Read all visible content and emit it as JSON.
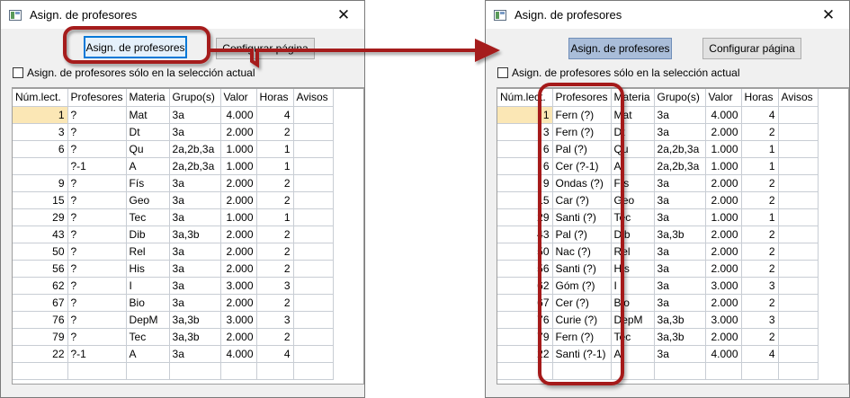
{
  "colors": {
    "callout": "#a51a1a",
    "selected_row": "#fbe7b5",
    "pressed_button": "#a9bdd9"
  },
  "left": {
    "window_title": "Asign. de profesores",
    "assign_button": "Asign. de profesores",
    "config_button": "Configurar página",
    "checkbox_label": "Asign. de profesores sólo en la selección actual",
    "columns": [
      "Núm.lect.",
      "Profesores",
      "Materia",
      "Grupo(s)",
      "Valor",
      "Horas",
      "Avisos"
    ],
    "rows": [
      [
        "1",
        "?",
        "Mat",
        "3a",
        "4.000",
        "4",
        ""
      ],
      [
        "3",
        "?",
        "Dt",
        "3a",
        "2.000",
        "2",
        ""
      ],
      [
        "6",
        "?",
        "Qu",
        "2a,2b,3a",
        "1.000",
        "1",
        ""
      ],
      [
        "",
        "?-1",
        "A",
        "2a,2b,3a",
        "1.000",
        "1",
        ""
      ],
      [
        "9",
        "?",
        "Fís",
        "3a",
        "2.000",
        "2",
        ""
      ],
      [
        "15",
        "?",
        "Geo",
        "3a",
        "2.000",
        "2",
        ""
      ],
      [
        "29",
        "?",
        "Tec",
        "3a",
        "1.000",
        "1",
        ""
      ],
      [
        "43",
        "?",
        "Dib",
        "3a,3b",
        "2.000",
        "2",
        ""
      ],
      [
        "50",
        "?",
        "Rel",
        "3a",
        "2.000",
        "2",
        ""
      ],
      [
        "56",
        "?",
        "His",
        "3a",
        "2.000",
        "2",
        ""
      ],
      [
        "62",
        "?",
        "I",
        "3a",
        "3.000",
        "3",
        ""
      ],
      [
        "67",
        "?",
        "Bio",
        "3a",
        "2.000",
        "2",
        ""
      ],
      [
        "76",
        "?",
        "DepM",
        "3a,3b",
        "3.000",
        "3",
        ""
      ],
      [
        "79",
        "?",
        "Tec",
        "3a,3b",
        "2.000",
        "2",
        ""
      ],
      [
        "22",
        "?-1",
        "A",
        "3a",
        "4.000",
        "4",
        ""
      ]
    ]
  },
  "right": {
    "window_title": "Asign. de profesores",
    "assign_button": "Asign. de profesores",
    "config_button": "Configurar página",
    "checkbox_label": "Asign. de profesores sólo en la selección actual",
    "columns": [
      "Núm.lect.",
      "Profesores",
      "Materia",
      "Grupo(s)",
      "Valor",
      "Horas",
      "Avisos"
    ],
    "rows": [
      [
        "1",
        "Fern (?)",
        "Mat",
        "3a",
        "4.000",
        "4",
        ""
      ],
      [
        "3",
        "Fern (?)",
        "Dt",
        "3a",
        "2.000",
        "2",
        ""
      ],
      [
        "6",
        "Pal (?)",
        "Qu",
        "2a,2b,3a",
        "1.000",
        "1",
        ""
      ],
      [
        "6",
        "Cer (?-1)",
        "A",
        "2a,2b,3a",
        "1.000",
        "1",
        ""
      ],
      [
        "9",
        "Ondas (?)",
        "Fís",
        "3a",
        "2.000",
        "2",
        ""
      ],
      [
        "15",
        "Car (?)",
        "Geo",
        "3a",
        "2.000",
        "2",
        ""
      ],
      [
        "29",
        "Santi (?)",
        "Tec",
        "3a",
        "1.000",
        "1",
        ""
      ],
      [
        "43",
        "Pal (?)",
        "Dib",
        "3a,3b",
        "2.000",
        "2",
        ""
      ],
      [
        "50",
        "Nac (?)",
        "Rel",
        "3a",
        "2.000",
        "2",
        ""
      ],
      [
        "56",
        "Santi (?)",
        "His",
        "3a",
        "2.000",
        "2",
        ""
      ],
      [
        "62",
        "Góm (?)",
        "I",
        "3a",
        "3.000",
        "3",
        ""
      ],
      [
        "67",
        "Cer (?)",
        "Bio",
        "3a",
        "2.000",
        "2",
        ""
      ],
      [
        "76",
        "Curie (?)",
        "DepM",
        "3a,3b",
        "3.000",
        "3",
        ""
      ],
      [
        "79",
        "Fern (?)",
        "Tec",
        "3a,3b",
        "2.000",
        "2",
        ""
      ],
      [
        "22",
        "Santi (?-1)",
        "A",
        "3a",
        "4.000",
        "4",
        ""
      ]
    ]
  }
}
